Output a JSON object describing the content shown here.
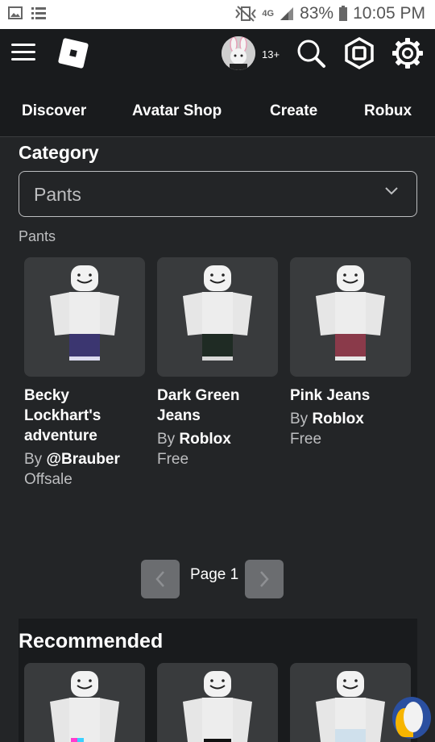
{
  "status_bar": {
    "battery": "83%",
    "time": "10:05 PM",
    "network": "4G"
  },
  "header": {
    "age_badge": "13+"
  },
  "tabs": [
    {
      "label": "Discover"
    },
    {
      "label": "Avatar Shop"
    },
    {
      "label": "Create"
    },
    {
      "label": "Robux"
    }
  ],
  "category": {
    "title": "Category",
    "selected": "Pants",
    "sub_label": "Pants"
  },
  "items": [
    {
      "name": "Becky Lockhart's adventure",
      "by": "By ",
      "creator": "@Brauber",
      "price": "Offsale",
      "pants_color": "#3b3670"
    },
    {
      "name": "Dark Green Jeans",
      "by": "By ",
      "creator": "Roblox",
      "price": "Free",
      "pants_color": "#1f2b24"
    },
    {
      "name": "Pink Jeans",
      "by": "By ",
      "creator": "Roblox",
      "price": "Free",
      "pants_color": "#8a3a4a"
    }
  ],
  "pager": {
    "label": "Page 1"
  },
  "recommended": {
    "title": "Recommended"
  },
  "colors": {
    "background": "#232527",
    "nav": "#191b1d",
    "card": "#393b3d",
    "muted_text": "#bdbec0"
  }
}
